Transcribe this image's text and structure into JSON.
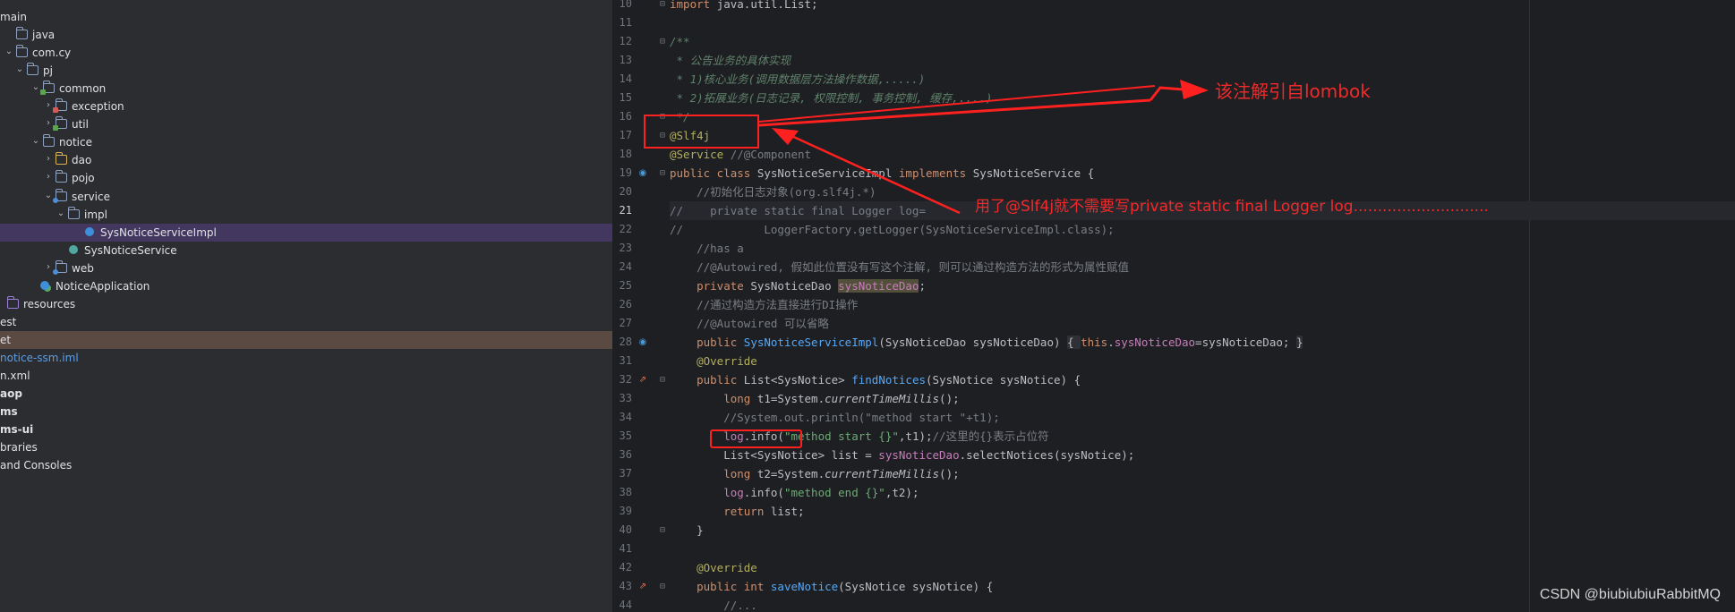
{
  "project_tree": {
    "rows": [
      {
        "label": "main",
        "arrow": "",
        "icon": "",
        "style": ""
      },
      {
        "label": "java",
        "arrow": "",
        "icon": "folder",
        "style": ""
      },
      {
        "label": "com.cy",
        "arrow": "v",
        "icon": "folder",
        "style": ""
      },
      {
        "label": "pj",
        "arrow": "v",
        "icon": "folder",
        "style": ""
      },
      {
        "label": "common",
        "arrow": "v",
        "icon": "folder",
        "badge": "green",
        "style": ""
      },
      {
        "label": "exception",
        "arrow": ">",
        "icon": "folder",
        "badge": "red",
        "style": ""
      },
      {
        "label": "util",
        "arrow": ">",
        "icon": "folder",
        "badge": "green",
        "style": ""
      },
      {
        "label": "notice",
        "arrow": "v",
        "icon": "folder",
        "style": ""
      },
      {
        "label": "dao",
        "arrow": ">",
        "icon": "folder-y",
        "style": ""
      },
      {
        "label": "pojo",
        "arrow": ">",
        "icon": "folder",
        "style": ""
      },
      {
        "label": "service",
        "arrow": "v",
        "icon": "folder",
        "badge": "blue",
        "style": ""
      },
      {
        "label": "impl",
        "arrow": "v",
        "icon": "folder",
        "style": ""
      },
      {
        "label": "SysNoticeServiceImpl",
        "arrow": "",
        "icon": "class",
        "style": "selected"
      },
      {
        "label": "SysNoticeService",
        "arrow": "",
        "icon": "interface",
        "style": ""
      },
      {
        "label": "web",
        "arrow": ">",
        "icon": "folder",
        "badge": "blue",
        "style": ""
      },
      {
        "label": "NoticeApplication",
        "arrow": "",
        "icon": "app",
        "style": ""
      },
      {
        "label": "resources",
        "arrow": "",
        "icon": "resources",
        "style": ""
      },
      {
        "label": "est",
        "arrow": "",
        "icon": "",
        "style": ""
      },
      {
        "label": "et",
        "arrow": "",
        "icon": "",
        "style": "highlight"
      },
      {
        "label": "notice-ssm.iml",
        "arrow": "",
        "icon": "",
        "style": "blue"
      },
      {
        "label": "n.xml",
        "arrow": "",
        "icon": "",
        "style": ""
      },
      {
        "label": "aop",
        "arrow": "",
        "icon": "",
        "style": "bold"
      },
      {
        "label": "ms",
        "arrow": "",
        "icon": "",
        "style": "bold"
      },
      {
        "label": "ms-ui",
        "arrow": "",
        "icon": "",
        "style": "bold"
      },
      {
        "label": "braries",
        "arrow": "",
        "icon": "",
        "style": ""
      },
      {
        "label": "and Consoles",
        "arrow": "",
        "icon": "",
        "style": ""
      }
    ]
  },
  "editor": {
    "current_line": "21",
    "lines": [
      {
        "n": "10",
        "mark": "",
        "fold": "⊖",
        "html": [
          [
            "kw",
            "import "
          ],
          [
            "type",
            "java.util.List;"
          ]
        ]
      },
      {
        "n": "11",
        "mark": "",
        "fold": "",
        "html": []
      },
      {
        "n": "12",
        "mark": "",
        "fold": "⊖",
        "html": [
          [
            "doc",
            "/**"
          ]
        ]
      },
      {
        "n": "13",
        "mark": "",
        "fold": "",
        "html": [
          [
            "doc",
            " * 公告业务的具体实现"
          ]
        ]
      },
      {
        "n": "14",
        "mark": "",
        "fold": "",
        "html": [
          [
            "doc",
            " * 1)核心业务(调用数据层方法操作数据,.....)"
          ]
        ]
      },
      {
        "n": "15",
        "mark": "",
        "fold": "",
        "html": [
          [
            "doc",
            " * 2)拓展业务(日志记录, 权限控制, 事务控制, 缓存,....)"
          ]
        ]
      },
      {
        "n": "16",
        "mark": "",
        "fold": "⊖",
        "html": [
          [
            "doc",
            " */"
          ]
        ]
      },
      {
        "n": "17",
        "mark": "",
        "fold": "⊖",
        "html": [
          [
            "ann",
            "@Slf4j"
          ]
        ]
      },
      {
        "n": "18",
        "mark": "",
        "fold": "",
        "html": [
          [
            "ann",
            "@Service "
          ],
          [
            "cmt",
            "//@Component"
          ]
        ]
      },
      {
        "n": "19",
        "mark": "bean",
        "fold": "⊖",
        "html": [
          [
            "kw",
            "public class "
          ],
          [
            "type",
            "SysNoticeServiceImpl "
          ],
          [
            "kw",
            "implements "
          ],
          [
            "type",
            "SysNoticeService {"
          ]
        ]
      },
      {
        "n": "20",
        "mark": "",
        "fold": "",
        "html": [
          [
            "cmt",
            "    //初始化日志对象(org.slf4j.*)"
          ]
        ]
      },
      {
        "n": "21",
        "mark": "",
        "fold": "",
        "html": [
          [
            "cmt",
            "//    private static final Logger log="
          ]
        ]
      },
      {
        "n": "22",
        "mark": "",
        "fold": "",
        "html": [
          [
            "cmt",
            "//            LoggerFactory.getLogger(SysNoticeServiceImpl.class);"
          ]
        ]
      },
      {
        "n": "23",
        "mark": "",
        "fold": "",
        "html": [
          [
            "cmt",
            "    //has a"
          ]
        ]
      },
      {
        "n": "24",
        "mark": "",
        "fold": "",
        "html": [
          [
            "cmt",
            "    //@Autowired, 假如此位置没有写这个注解, 则可以通过构造方法的形式为属性赋值"
          ]
        ]
      },
      {
        "n": "25",
        "mark": "",
        "fold": "",
        "html": [
          [
            "kw",
            "    private "
          ],
          [
            "type",
            "SysNoticeDao "
          ],
          [
            "hl",
            "sysNoticeDao"
          ],
          [
            "type",
            ";"
          ]
        ]
      },
      {
        "n": "26",
        "mark": "",
        "fold": "",
        "html": [
          [
            "cmt",
            "    //通过构造方法直接进行DI操作"
          ]
        ]
      },
      {
        "n": "27",
        "mark": "",
        "fold": "",
        "html": [
          [
            "cmt",
            "    //@Autowired 可以省略"
          ]
        ]
      },
      {
        "n": "28",
        "mark": "bean",
        "fold": "",
        "html": [
          [
            "kw",
            "    public "
          ],
          [
            "fn",
            "SysNoticeServiceImpl"
          ],
          [
            "type",
            "(SysNoticeDao sysNoticeDao) "
          ],
          [
            "fold",
            "{ "
          ],
          [
            "kw",
            "this"
          ],
          [
            "type",
            "."
          ],
          [
            "fld",
            "sysNoticeDao"
          ],
          [
            "type",
            "=sysNoticeDao; "
          ],
          [
            "fold",
            "}"
          ]
        ]
      },
      {
        "n": "31",
        "mark": "",
        "fold": "",
        "html": [
          [
            "ann",
            "    @Override"
          ]
        ]
      },
      {
        "n": "32",
        "mark": "impl",
        "fold": "⊖",
        "html": [
          [
            "kw",
            "    public "
          ],
          [
            "type",
            "List<SysNotice> "
          ],
          [
            "fn",
            "findNotices"
          ],
          [
            "type",
            "(SysNotice sysNotice) {"
          ]
        ]
      },
      {
        "n": "33",
        "mark": "",
        "fold": "",
        "html": [
          [
            "kw",
            "        long "
          ],
          [
            "type",
            "t1=System."
          ],
          [
            "st",
            "currentTimeMillis"
          ],
          [
            "type",
            "();"
          ]
        ]
      },
      {
        "n": "34",
        "mark": "",
        "fold": "",
        "html": [
          [
            "cmt",
            "        //System.out.println(\"method start \"+t1);"
          ]
        ]
      },
      {
        "n": "35",
        "mark": "",
        "fold": "",
        "html": [
          [
            "fld",
            "        log"
          ],
          [
            "type",
            ".info("
          ],
          [
            "str",
            "\"method start {}\""
          ],
          [
            "type",
            ",t1);"
          ],
          [
            "cmt",
            "//这里的{}表示占位符"
          ]
        ]
      },
      {
        "n": "36",
        "mark": "",
        "fold": "",
        "html": [
          [
            "type",
            "        List<SysNotice> list = "
          ],
          [
            "fld",
            "sysNoticeDao"
          ],
          [
            "type",
            ".selectNotices(sysNotice);"
          ]
        ]
      },
      {
        "n": "37",
        "mark": "",
        "fold": "",
        "html": [
          [
            "kw",
            "        long "
          ],
          [
            "type",
            "t2=System."
          ],
          [
            "st",
            "currentTimeMillis"
          ],
          [
            "type",
            "();"
          ]
        ]
      },
      {
        "n": "38",
        "mark": "",
        "fold": "",
        "html": [
          [
            "fld",
            "        log"
          ],
          [
            "type",
            ".info("
          ],
          [
            "str",
            "\"method end {}\""
          ],
          [
            "type",
            ",t2);"
          ]
        ]
      },
      {
        "n": "39",
        "mark": "",
        "fold": "",
        "html": [
          [
            "kw",
            "        return "
          ],
          [
            "type",
            "list;"
          ]
        ]
      },
      {
        "n": "40",
        "mark": "",
        "fold": "⊖",
        "html": [
          [
            "type",
            "    }"
          ]
        ]
      },
      {
        "n": "41",
        "mark": "",
        "fold": "",
        "html": []
      },
      {
        "n": "42",
        "mark": "",
        "fold": "",
        "html": [
          [
            "ann",
            "    @Override"
          ]
        ]
      },
      {
        "n": "43",
        "mark": "impl",
        "fold": "⊖",
        "html": [
          [
            "kw",
            "    public int "
          ],
          [
            "fn",
            "saveNotice"
          ],
          [
            "type",
            "(SysNotice sysNotice) {"
          ]
        ]
      },
      {
        "n": "44",
        "mark": "",
        "fold": "",
        "html": [
          [
            "cmt",
            "        //..."
          ]
        ]
      }
    ]
  },
  "annotations": {
    "note1": "该注解引自lombok",
    "note2": "用了@Slf4j就不需要写private static final Logger log............................",
    "color": "#f02a2a"
  },
  "watermark": "CSDN @biubiubiuRabbitMQ"
}
